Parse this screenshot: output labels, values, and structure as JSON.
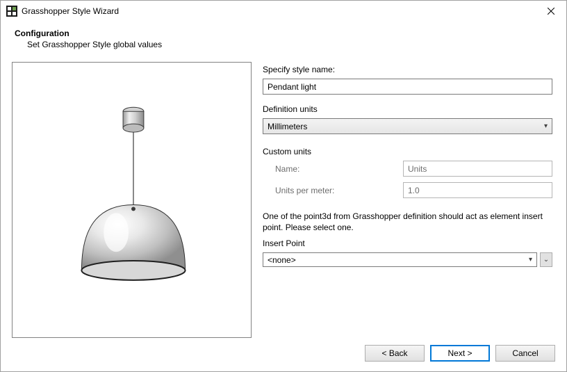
{
  "window": {
    "title": "Grasshopper Style Wizard"
  },
  "header": {
    "title": "Configuration",
    "subtitle": "Set Grasshopper Style global values"
  },
  "form": {
    "style_name": {
      "label": "Specify style name:",
      "value": "Pendant light"
    },
    "definition_units": {
      "label": "Definition units",
      "value": "Millimeters"
    },
    "custom_units": {
      "label": "Custom units",
      "name_label": "Name:",
      "name_value": "Units",
      "upm_label": "Units per meter:",
      "upm_value": "1.0"
    },
    "insert_info": "One of the point3d from Grasshopper definition should act as element insert point. Please select one.",
    "insert_point": {
      "label": "Insert Point",
      "value": "<none>"
    }
  },
  "buttons": {
    "back": "< Back",
    "next": "Next >",
    "cancel": "Cancel"
  }
}
